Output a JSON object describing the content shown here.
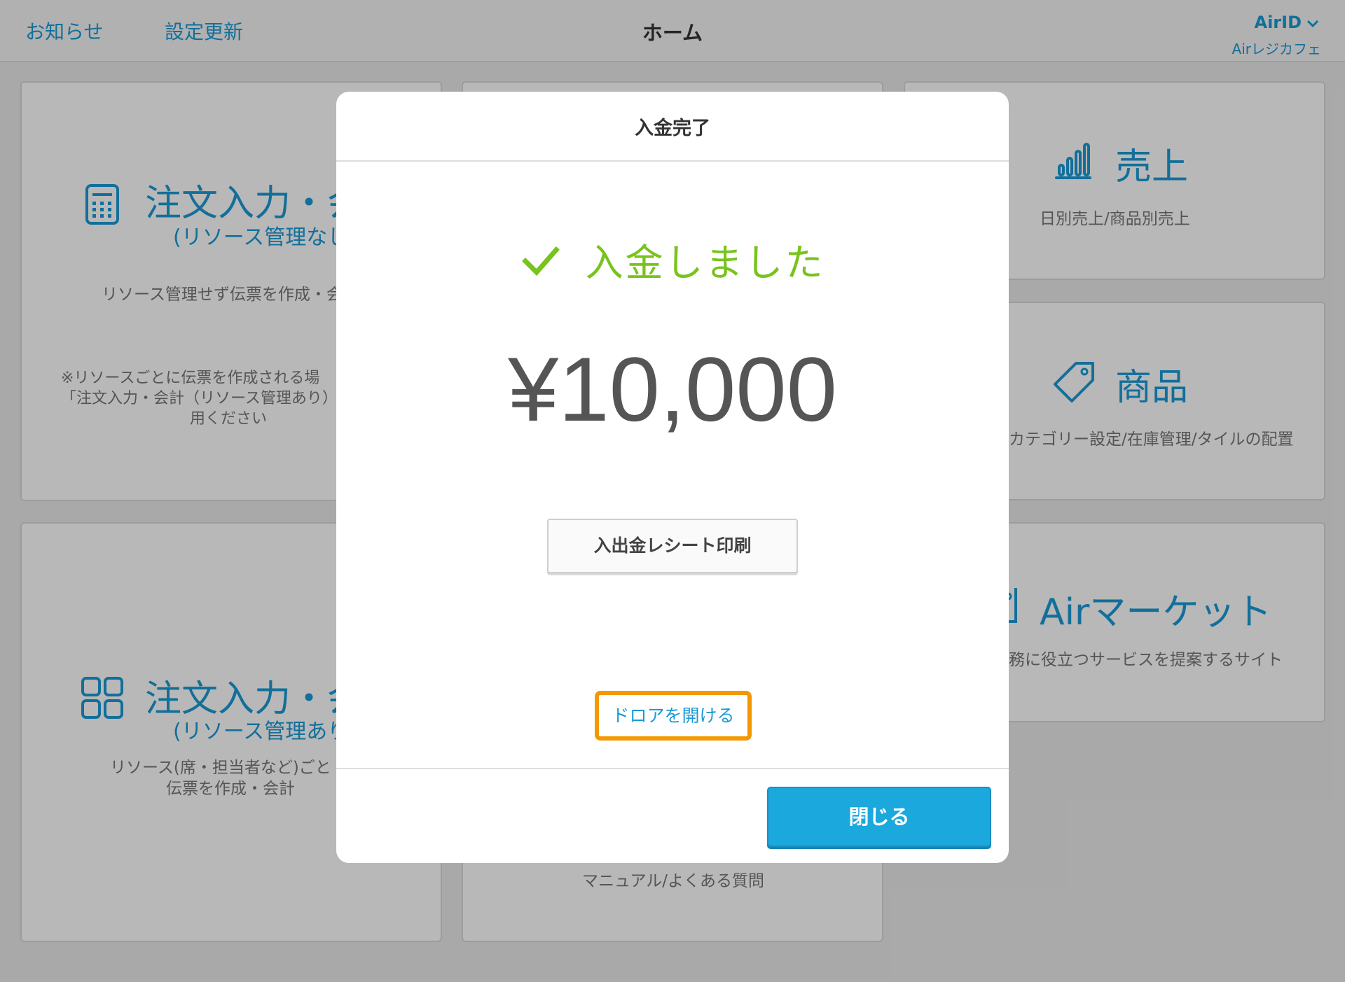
{
  "header": {
    "notice_label": "お知らせ",
    "settings_update_label": "設定更新",
    "title": "ホーム",
    "airid_label": "AirID",
    "account_name": "Airレジカフェ"
  },
  "cards": {
    "order_no_resource": {
      "title": "注文入力・会",
      "subtitle": "(リソース管理なし",
      "desc1": "リソース管理せず伝票を作成・会",
      "note1": "※リソースごとに伝票を作成される場",
      "note2": "「注文入力・会計（リソース管理あり）",
      "note3": "用ください"
    },
    "order_with_resource": {
      "title": "注文入力・会",
      "subtitle": "(リソース管理あり",
      "desc1": "リソース(席・担当者など)ごと",
      "desc2": "伝票を作成・会計"
    },
    "sales": {
      "title": "売上",
      "desc": "日別売上/商品別売上"
    },
    "products": {
      "title": "商品",
      "desc": "カテゴリー設定/在庫管理/タイルの配置"
    },
    "air_market": {
      "title": "Airマーケット",
      "desc": "務に役立つサービスを提案するサイト"
    },
    "help": {
      "desc": "マニュアル/よくある質問"
    }
  },
  "modal": {
    "title": "入金完了",
    "success_message": "入金しました",
    "amount": "¥10,000",
    "receipt_button": "入出金レシート印刷",
    "open_drawer_link": "ドロアを開ける",
    "close_button": "閉じる"
  },
  "colors": {
    "accent": "#1a9ad6",
    "success": "#78c31c",
    "highlight": "#f39800",
    "primary_button": "#1aa8dd"
  }
}
